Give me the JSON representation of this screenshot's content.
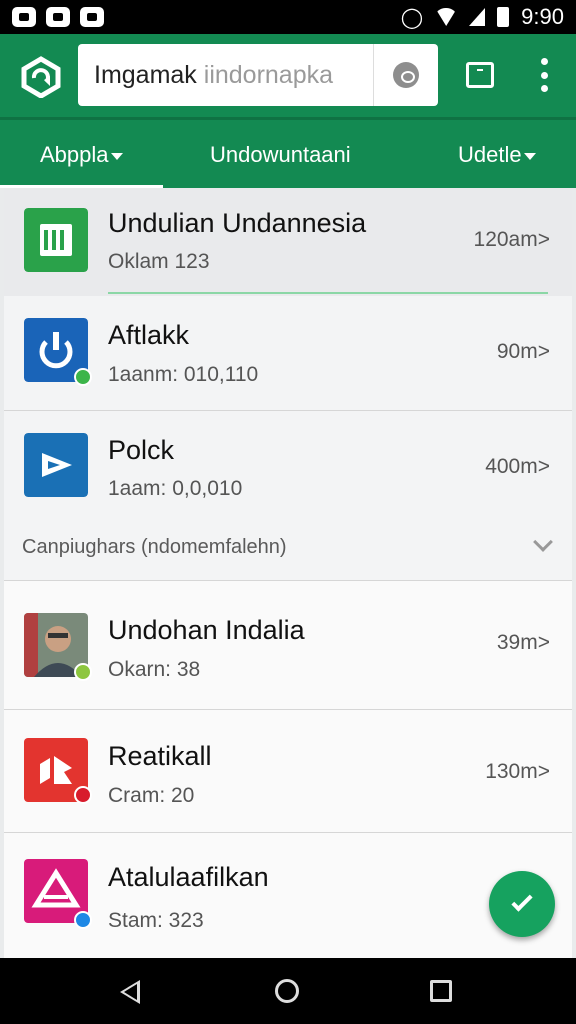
{
  "status_bar": {
    "time": "9:90"
  },
  "search": {
    "value": "Imgamak",
    "placeholder": " iindornapka"
  },
  "tabs": [
    {
      "label": "Abppla"
    },
    {
      "label": "Undowuntaani"
    },
    {
      "label": "Udetle"
    }
  ],
  "apps": [
    {
      "title": "Undulian Undannesia",
      "subtitle": "Oklam 123",
      "size": "120am>"
    },
    {
      "title": "Aftlakk",
      "subtitle": "1aanm: 010,110",
      "size": "90m>"
    },
    {
      "title": "Polck",
      "subtitle": "1aam: 0,0,010",
      "size": "400m>"
    }
  ],
  "group_label": "Canpiughars (ndomemfalehn)",
  "apps2": [
    {
      "title": "Undohan Indalia",
      "subtitle": "Okarn: 38",
      "size": "39m>"
    },
    {
      "title": "Reatikall",
      "subtitle": "Cram: 20",
      "size": "130m>"
    },
    {
      "title": "Atalulaafilkan",
      "subtitle": "Stam: 323",
      "size": ""
    }
  ],
  "colors": {
    "brand": "#138a52",
    "fab": "#16a25f"
  }
}
